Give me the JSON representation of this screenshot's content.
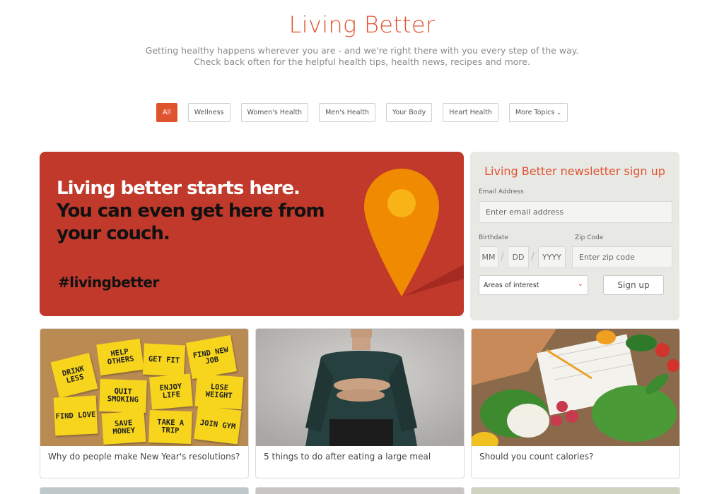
{
  "header": {
    "title": "Living Better",
    "subtitle_line1": "Getting healthy happens wherever you are - and we're right there with you every step of the way.",
    "subtitle_line2": "Check back often for the helpful health tips, health news, recipes and more."
  },
  "filters": [
    {
      "label": "All",
      "active": true
    },
    {
      "label": "Wellness",
      "active": false
    },
    {
      "label": "Women's Health",
      "active": false
    },
    {
      "label": "Men's Health",
      "active": false
    },
    {
      "label": "Your Body",
      "active": false
    },
    {
      "label": "Heart Health",
      "active": false
    },
    {
      "label": "More Topics",
      "active": false
    }
  ],
  "hero": {
    "line1": "Living better starts here.",
    "line2": "You can even get here from",
    "line3": "your couch.",
    "hashtag": "#livingbetter"
  },
  "newsletter": {
    "title": "Living Better newsletter sign up",
    "email_label": "Email Address",
    "email_placeholder": "Enter email address",
    "birthdate_label": "Birthdate",
    "month_placeholder": "MM",
    "day_placeholder": "DD",
    "year_placeholder": "YYYY",
    "zip_label": "Zip Code",
    "zip_placeholder": "Enter zip code",
    "interest_select": "Areas of interest",
    "signup_label": "Sign up"
  },
  "cards": [
    {
      "caption": "Why do people make New Year's resolutions?"
    },
    {
      "caption": "5 things to do after eating a large meal"
    },
    {
      "caption": "Should you count calories?"
    }
  ],
  "sticky_notes": [
    {
      "text": "HELP OTHERS"
    },
    {
      "text": "GET FIT"
    },
    {
      "text": "FIND NEW JOB"
    },
    {
      "text": "DRINK LESS"
    },
    {
      "text": "QUIT SMOKING"
    },
    {
      "text": "ENJOY LIFE"
    },
    {
      "text": "LOSE WEIGHT"
    },
    {
      "text": "FIND LOVE"
    },
    {
      "text": "SAVE MONEY"
    },
    {
      "text": "TAKE A TRIP"
    },
    {
      "text": "JOIN GYM"
    }
  ],
  "colors": {
    "accent": "#e0532f",
    "hero_bg": "#c0392b",
    "pin": "#f08a00",
    "panel_bg": "#e8e8e5"
  }
}
